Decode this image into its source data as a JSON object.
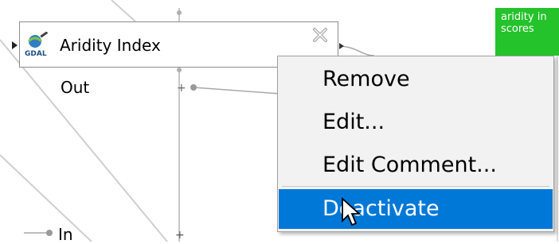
{
  "node": {
    "title": "Aridity Index",
    "icon": "gdal-icon",
    "output_label": "Out",
    "close_icon": "close-icon"
  },
  "input_port": {
    "label": "In"
  },
  "side_node": {
    "line1": "aridity in",
    "line2": "scores",
    "color": "#24c22b"
  },
  "context_menu": {
    "items": [
      {
        "label": "Remove"
      },
      {
        "label": "Edit..."
      },
      {
        "label": "Edit Comment..."
      },
      {
        "label": "Deactivate",
        "highlighted": true
      }
    ],
    "highlight_color": "#0078d7"
  }
}
